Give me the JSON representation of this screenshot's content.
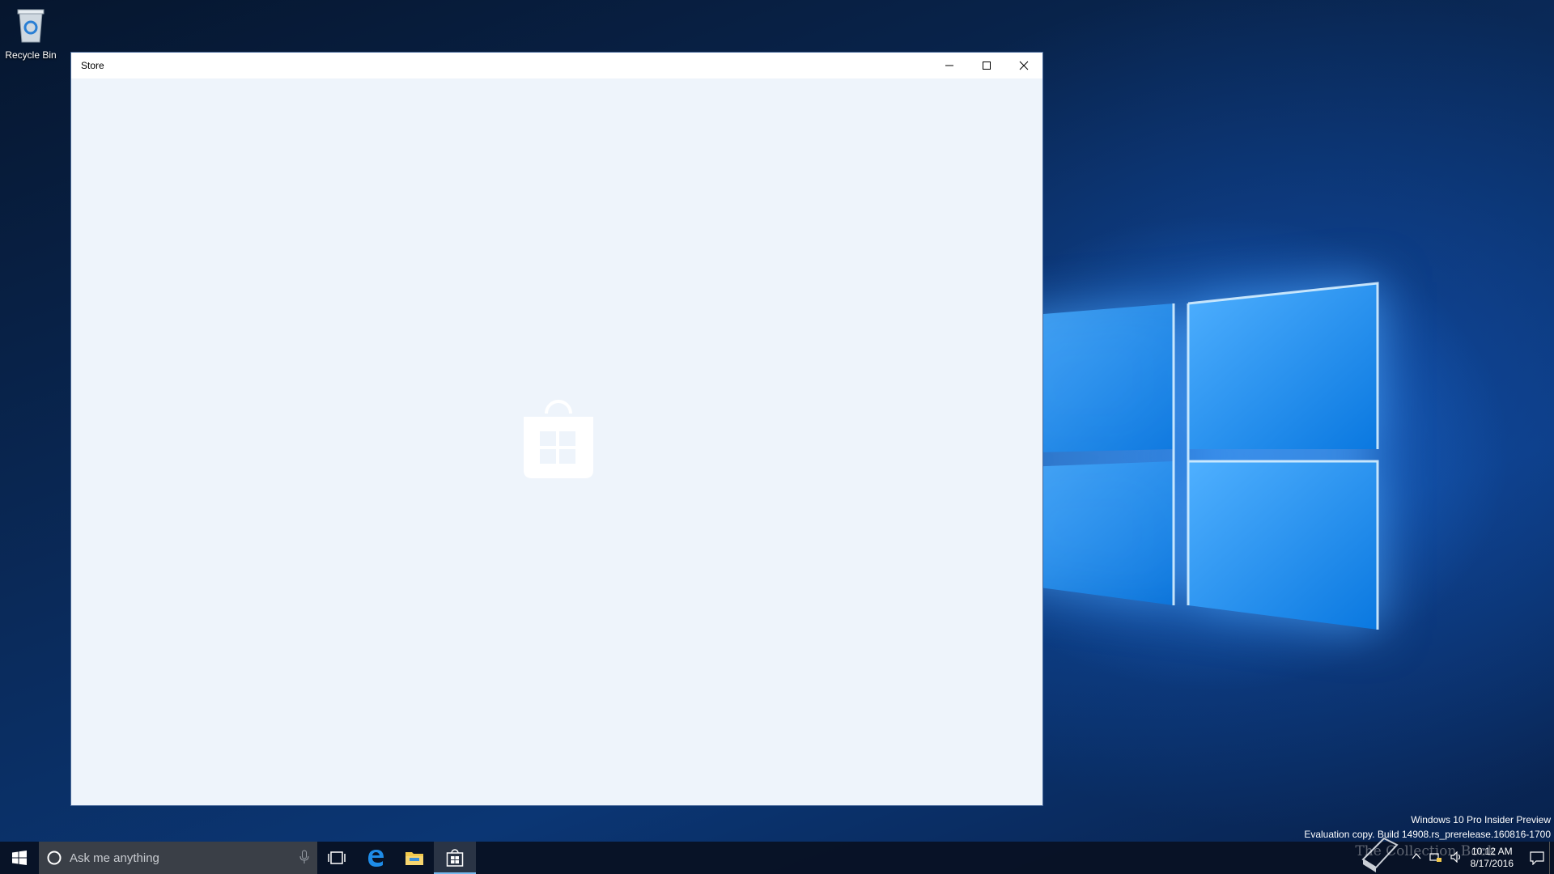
{
  "desktop": {
    "icons": [
      {
        "label": "Recycle Bin",
        "icon": "recycle-bin-icon"
      }
    ]
  },
  "window": {
    "title": "Store",
    "buttons": {
      "minimize": "minimize-icon",
      "maximize": "maximize-icon",
      "close": "close-icon"
    },
    "splash_icon": "store-bag-icon",
    "background_color": "#eef4fb"
  },
  "watermark": {
    "line1": "Windows 10 Pro Insider Preview",
    "line2": "Evaluation copy. Build 14908.rs_prerelease.160816-1700"
  },
  "taskbar": {
    "search_placeholder": "Ask me anything",
    "pinned": [
      {
        "name": "Task View",
        "icon": "task-view-icon"
      },
      {
        "name": "Microsoft Edge",
        "icon": "edge-icon"
      },
      {
        "name": "File Explorer",
        "icon": "folder-icon"
      },
      {
        "name": "Store",
        "icon": "store-icon",
        "active": true
      }
    ],
    "clock": {
      "time": "10:12 AM",
      "date": "8/17/2016"
    },
    "overlay_text": "The Collection Book",
    "accent_color": "#76b9ed"
  }
}
